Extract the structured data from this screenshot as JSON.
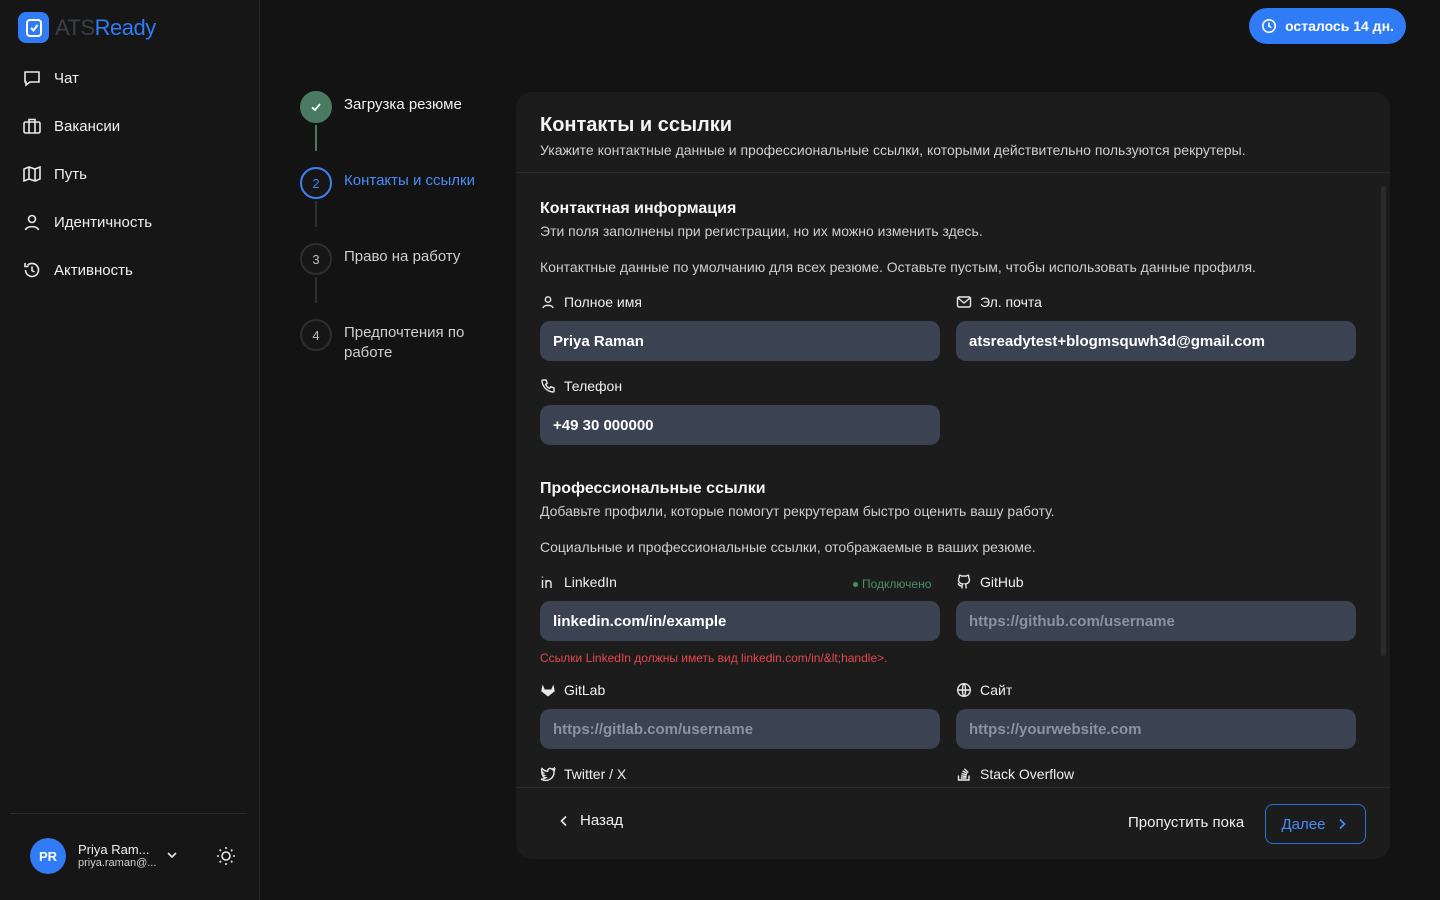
{
  "brand": {
    "name_part1": "ATS",
    "name_part2": "Ready",
    "accent": "#2f7cf6"
  },
  "sidebar": {
    "items": [
      {
        "label": "Чат",
        "icon": "chat-icon"
      },
      {
        "label": "Вакансии",
        "icon": "briefcase-icon"
      },
      {
        "label": "Путь",
        "icon": "map-icon"
      },
      {
        "label": "Идентичность",
        "icon": "user-icon"
      },
      {
        "label": "Активность",
        "icon": "history-icon"
      }
    ],
    "user": {
      "initials": "PR",
      "name": "Priya Ram...",
      "email": "priya.raman@..."
    }
  },
  "trial": {
    "label": "осталось 14 дн."
  },
  "stepper": {
    "steps": [
      {
        "number": "1",
        "label": "Загрузка резюме",
        "state": "done"
      },
      {
        "number": "2",
        "label": "Контакты и ссылки",
        "state": "active"
      },
      {
        "number": "3",
        "label": "Право на работу",
        "state": "pending"
      },
      {
        "number": "4",
        "label": "Предпочтения по работе",
        "state": "pending"
      }
    ]
  },
  "card": {
    "title": "Контакты и ссылки",
    "subtitle": "Укажите контактные данные и профессиональные ссылки, которыми действительно пользуются рекрутеры.",
    "contact": {
      "title": "Контактная информация",
      "subtitle": "Эти поля заполнены при регистрации, но их можно изменить здесь.",
      "note": "Контактные данные по умолчанию для всех резюме. Оставьте пустым, чтобы использовать данные профиля.",
      "name_label": "Полное имя",
      "name_value": "Priya Raman",
      "email_label": "Эл. почта",
      "email_value": "atsreadytest+blogmsquwh3d@gmail.com",
      "phone_label": "Телефон",
      "phone_value": "+49 30 000000"
    },
    "links": {
      "title": "Профессиональные ссылки",
      "subtitle": "Добавьте профили, которые помогут рекрутерам быстро оценить вашу работу.",
      "note": "Социальные и профессиональные ссылки, отображаемые в ваших резюме.",
      "linkedin_label": "LinkedIn",
      "linkedin_status": "Подключено",
      "linkedin_value": "linkedin.com/in/example",
      "linkedin_error": "Ссылки LinkedIn должны иметь вид linkedin.com/in/&lt;handle>.",
      "github_label": "GitHub",
      "github_placeholder": "https://github.com/username",
      "gitlab_label": "GitLab",
      "gitlab_placeholder": "https://gitlab.com/username",
      "website_label": "Сайт",
      "website_placeholder": "https://yourwebsite.com",
      "twitter_label": "Twitter / X",
      "stackoverflow_label": "Stack Overflow"
    },
    "footer": {
      "back": "Назад",
      "skip": "Пропустить пока",
      "next": "Далее"
    }
  }
}
